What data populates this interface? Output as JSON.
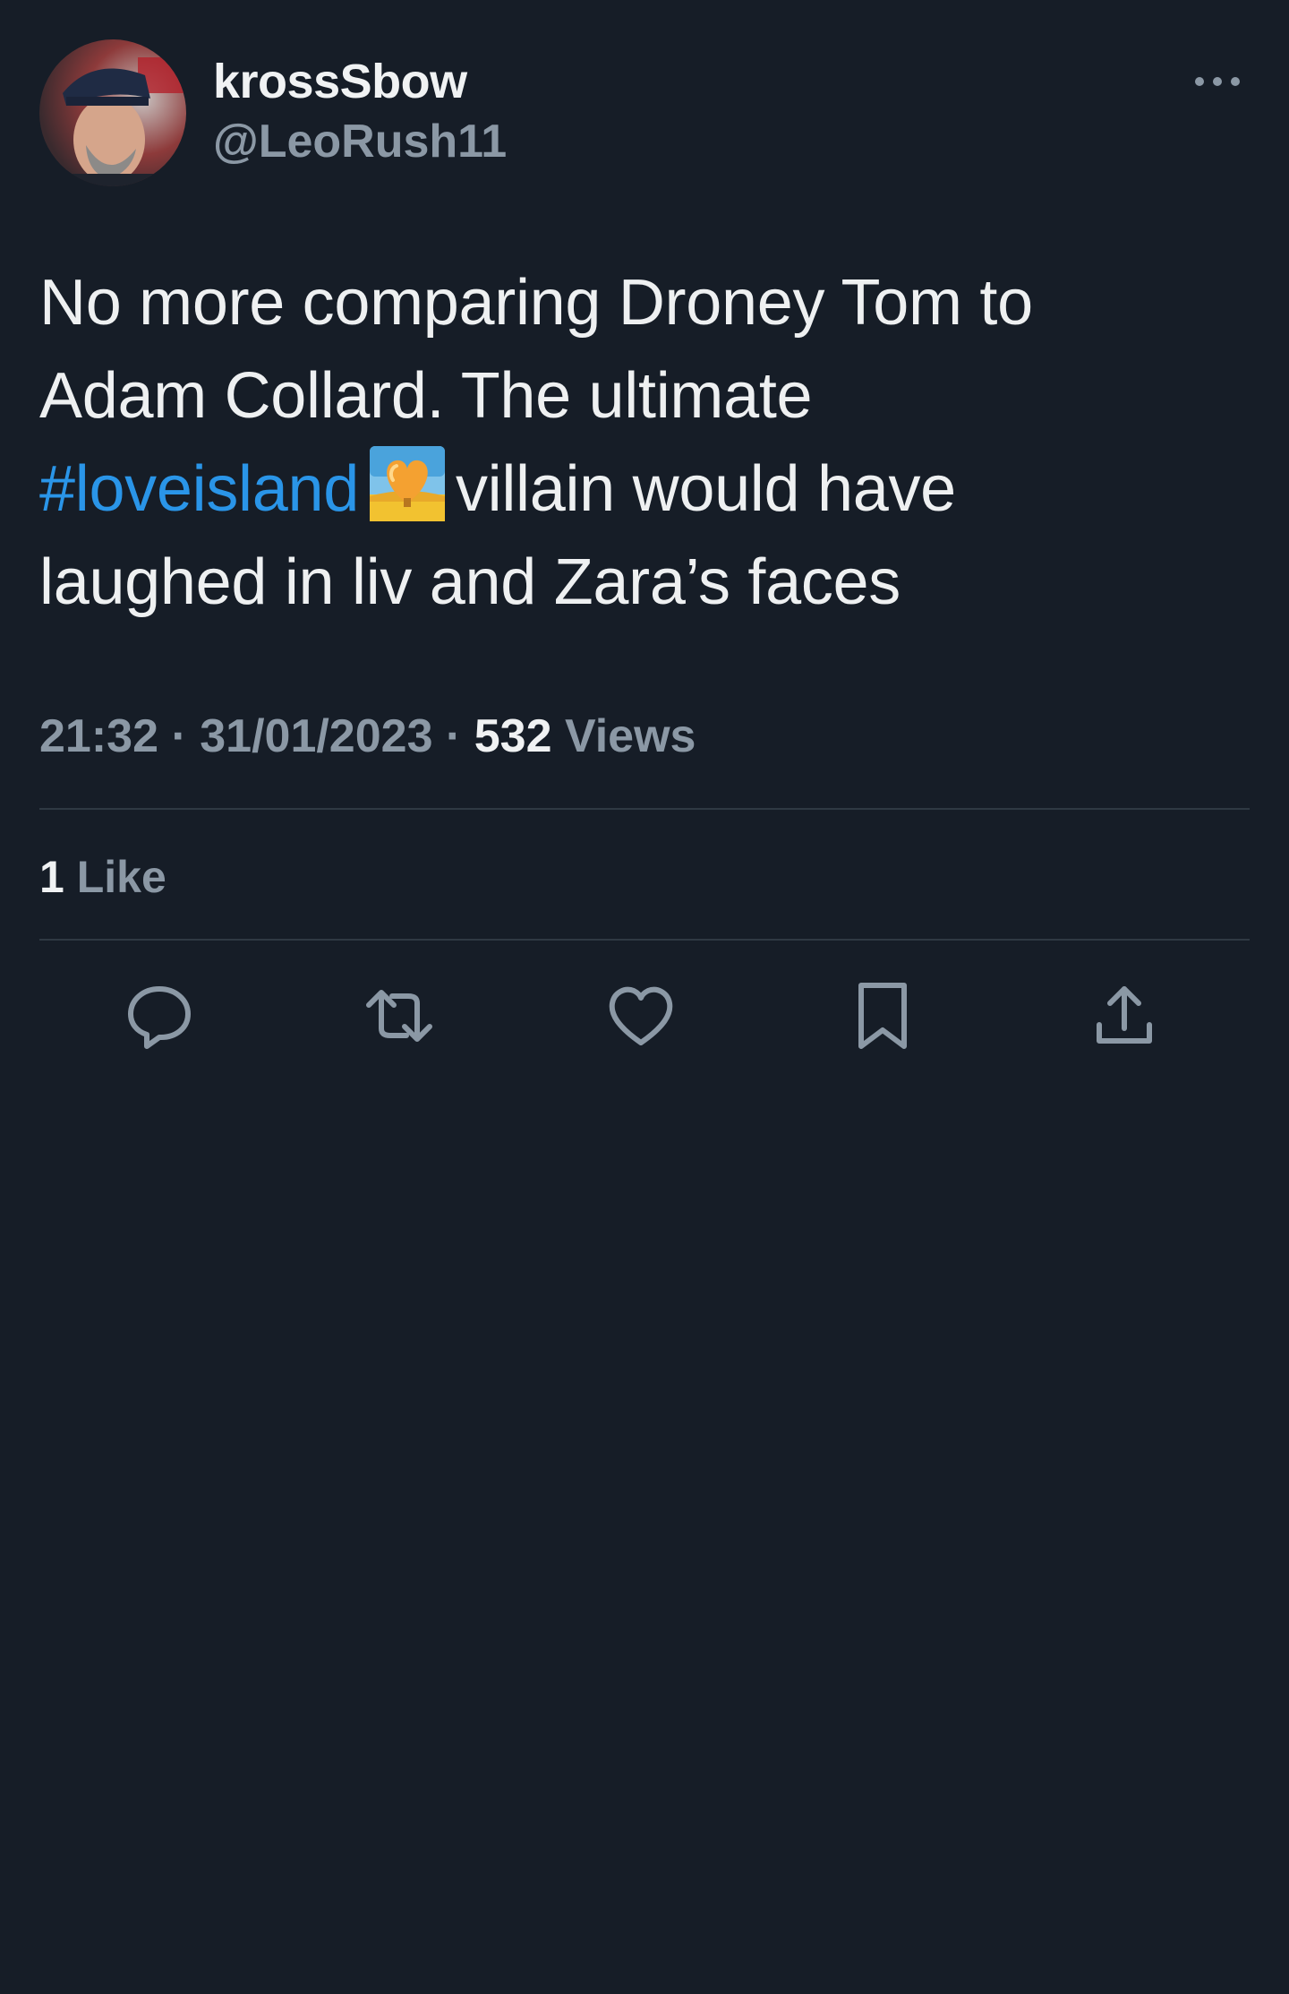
{
  "tweet": {
    "display_name": "krossSbow",
    "handle": "@LeoRush11",
    "text_line1": "No more comparing Droney Tom to",
    "text_line2": "Adam Collard. The ultimate",
    "hashtag": "#loveisland",
    "text_after_emoji": "villain would have",
    "text_line4": "laughed in liv and Zara’s faces",
    "time": "21:32",
    "separator": "·",
    "date": "31/01/2023",
    "views_count": "532",
    "views_label": "Views",
    "likes_count": "1",
    "likes_label": "Like"
  },
  "icons": {
    "more": "more-horizontal-icon",
    "emoji": "desert-island-emoji",
    "reply": "reply-icon",
    "retweet": "retweet-icon",
    "like": "heart-icon",
    "bookmark": "bookmark-icon",
    "share": "share-icon"
  },
  "colors": {
    "background": "#161d27",
    "text": "#eef0f1",
    "secondary": "#8b98a5",
    "hashtag": "#2a95e8",
    "divider": "#2f3943"
  }
}
